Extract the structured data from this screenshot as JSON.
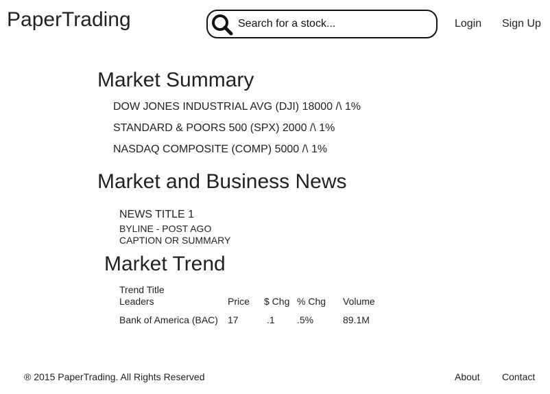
{
  "header": {
    "brand": "PaperTrading",
    "search_placeholder": "Search for a stock...",
    "search_icon": "search-icon",
    "nav": {
      "login": "Login",
      "signup": "Sign Up"
    }
  },
  "market_summary": {
    "title": "Market Summary",
    "items": [
      "DOW JONES INDUSTRIAL AVG (DJI) 18000 /\\ 1%",
      "STANDARD & POORS 500 (SPX) 2000 /\\ 1%",
      "NASDAQ COMPOSITE (COMP) 5000 /\\ 1%"
    ]
  },
  "news": {
    "title": "Market and Business News",
    "items": [
      {
        "headline": "NEWS TITLE 1",
        "byline": "BYLINE - POST AGO",
        "caption": "CAPTION OR SUMMARY"
      }
    ]
  },
  "trend": {
    "title": "Market Trend",
    "subtitle": "Trend Title",
    "columns": [
      "Leaders",
      "Price",
      "$ Chg",
      "% Chg",
      "Volume"
    ],
    "rows": [
      [
        "Bank of America (BAC)",
        "17",
        ".1",
        ".5%",
        "89.1M"
      ]
    ]
  },
  "footer": {
    "copyright": "® 2015 PaperTrading. All Rights Reserved",
    "about": "About",
    "contact": "Contact"
  }
}
